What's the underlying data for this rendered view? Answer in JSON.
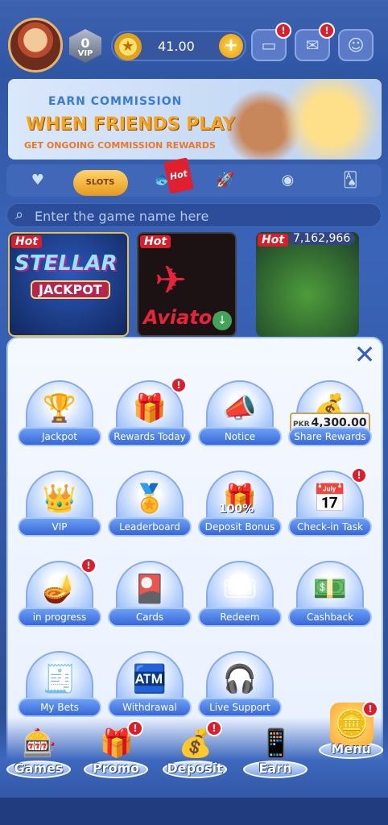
{
  "header": {
    "vip_level": "0",
    "vip_label": "VIP",
    "balance": "41.00",
    "wallet_badge": "!",
    "mail_badge": "!"
  },
  "banner": {
    "line1": "EARN COMMISSION",
    "line2": "WHEN FRIENDS PLAY",
    "line3": "GET ONGOING COMMISSION REWARDS"
  },
  "categories": {
    "slots_label": "SLOTS",
    "hot_tag": "Hot"
  },
  "search": {
    "placeholder": "Enter the game name here"
  },
  "games": [
    {
      "hot": "Hot",
      "title": "STELLAR",
      "subtitle": "JACKPOT"
    },
    {
      "hot": "Hot",
      "title": "Aviator"
    },
    {
      "hot": "Hot",
      "jackpot": "7,162,966"
    }
  ],
  "menu": {
    "items": [
      {
        "label": "Jackpot",
        "icon": "trophy-icon",
        "glyph": "🏆"
      },
      {
        "label": "Rewards Today",
        "icon": "gift-icon",
        "glyph": "🎁",
        "badge": "!"
      },
      {
        "label": "Notice",
        "icon": "megaphone-icon",
        "glyph": "📣"
      },
      {
        "label": "Share Rewards",
        "icon": "treasure-icon",
        "glyph": "💰",
        "currency": "PKR",
        "amount": "4,300.00"
      },
      {
        "label": "VIP",
        "icon": "crown-icon",
        "glyph": "👑"
      },
      {
        "label": "Leaderboard",
        "icon": "podium-icon",
        "glyph": "🏅"
      },
      {
        "label": "Deposit Bonus",
        "icon": "deposit-gift-icon",
        "glyph": "🎁",
        "percent": "100%"
      },
      {
        "label": "Check-in Task",
        "icon": "calendar-icon",
        "glyph": "📅",
        "badge": "!"
      },
      {
        "label": "in progress",
        "icon": "lamp-icon",
        "glyph": "🪔",
        "badge": "!"
      },
      {
        "label": "Cards",
        "icon": "card-icon",
        "glyph": "🎴"
      },
      {
        "label": "Redeem",
        "icon": "code-icon",
        "glyph": "🎟"
      },
      {
        "label": "Cashback",
        "icon": "cashback-icon",
        "glyph": "💵"
      },
      {
        "label": "My Bets",
        "icon": "receipt-icon",
        "glyph": "🧾"
      },
      {
        "label": "Withdrawal",
        "icon": "atm-icon",
        "glyph": "🏧"
      },
      {
        "label": "Live Support",
        "icon": "support-icon",
        "glyph": "🎧"
      }
    ]
  },
  "bottom_nav": [
    {
      "label": "Games",
      "icon": "games-icon",
      "glyph": "🎰"
    },
    {
      "label": "Promo",
      "icon": "promo-icon",
      "glyph": "🎁",
      "badge": "!"
    },
    {
      "label": "Deposit",
      "icon": "deposit-icon",
      "glyph": "💰",
      "badge": "!"
    },
    {
      "label": "Earn",
      "icon": "earn-icon",
      "glyph": "📱"
    },
    {
      "label": "Menu",
      "icon": "menu-icon",
      "glyph": "🪙",
      "badge": "!"
    }
  ]
}
